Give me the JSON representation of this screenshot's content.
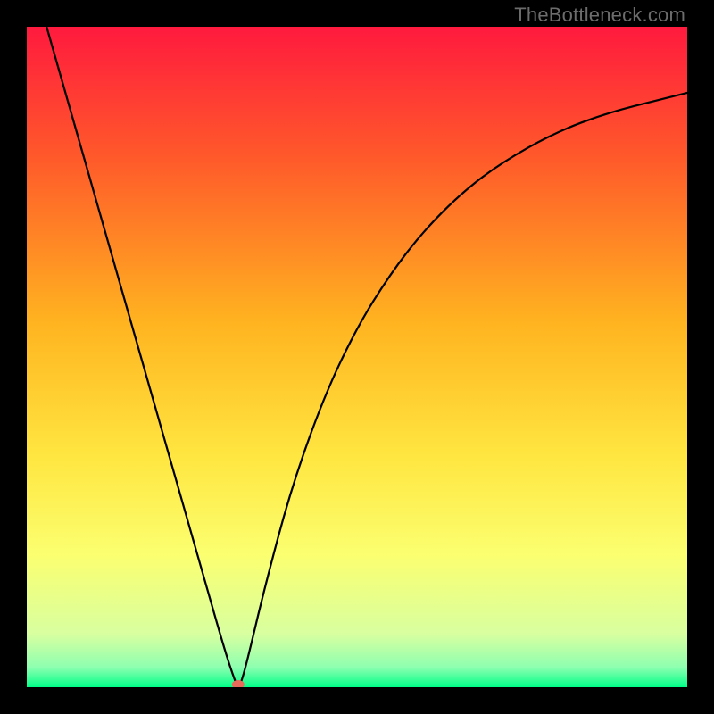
{
  "watermark": "TheBottleneck.com",
  "chart_data": {
    "type": "line",
    "title": "",
    "xlabel": "",
    "ylabel": "",
    "xlim": [
      0,
      1
    ],
    "ylim": [
      0,
      1
    ],
    "grid": false,
    "legend": false,
    "background_gradient": {
      "stops": [
        {
          "offset": 0.0,
          "color": "#ff1a3e"
        },
        {
          "offset": 0.2,
          "color": "#ff5a2a"
        },
        {
          "offset": 0.45,
          "color": "#ffb420"
        },
        {
          "offset": 0.65,
          "color": "#ffe640"
        },
        {
          "offset": 0.8,
          "color": "#fbff70"
        },
        {
          "offset": 0.92,
          "color": "#d8ffa0"
        },
        {
          "offset": 0.97,
          "color": "#8dffb0"
        },
        {
          "offset": 1.0,
          "color": "#00ff88"
        }
      ]
    },
    "series": [
      {
        "name": "curve",
        "color": "#000000",
        "x": [
          0.03,
          0.06,
          0.09,
          0.12,
          0.15,
          0.18,
          0.21,
          0.24,
          0.27,
          0.3,
          0.315,
          0.32,
          0.325,
          0.335,
          0.36,
          0.4,
          0.45,
          0.5,
          0.55,
          0.6,
          0.66,
          0.72,
          0.8,
          0.88,
          0.96,
          1.0
        ],
        "values": [
          1.0,
          0.895,
          0.79,
          0.685,
          0.58,
          0.475,
          0.37,
          0.265,
          0.16,
          0.055,
          0.01,
          0.0,
          0.008,
          0.045,
          0.15,
          0.3,
          0.44,
          0.545,
          0.625,
          0.69,
          0.75,
          0.795,
          0.84,
          0.87,
          0.89,
          0.9
        ]
      }
    ],
    "marker": {
      "x": 0.32,
      "y": 0.0,
      "color": "#e86a5a",
      "rx": 7,
      "ry": 5
    }
  }
}
